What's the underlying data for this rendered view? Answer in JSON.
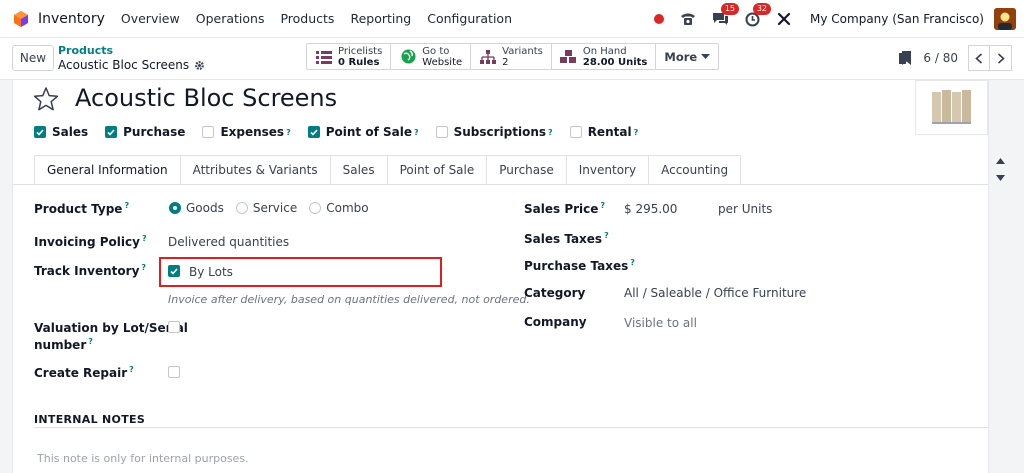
{
  "navbar": {
    "app_name": "Inventory",
    "menu": [
      "Overview",
      "Operations",
      "Products",
      "Reporting",
      "Configuration"
    ],
    "messages_badge": "15",
    "activities_badge": "32",
    "company": "My Company (San Francisco)"
  },
  "control": {
    "new_label": "New",
    "breadcrumb_parent": "Products",
    "breadcrumb_current": "Acoustic Bloc Screens",
    "smart_buttons": {
      "pricelists_title": "Pricelists",
      "pricelists_value": "0 Rules",
      "website_title": "Go to",
      "website_value": "Website",
      "variants_title": "Variants",
      "variants_value": "2",
      "onhand_title": "On Hand",
      "onhand_value": "28.00 Units",
      "more_label": "More"
    },
    "pager": "6 / 80"
  },
  "product": {
    "name": "Acoustic Bloc Screens",
    "flags": {
      "sales": "Sales",
      "purchase": "Purchase",
      "expenses": "Expenses",
      "pos": "Point of Sale",
      "subscriptions": "Subscriptions",
      "rental": "Rental"
    }
  },
  "tabs": [
    "General Information",
    "Attributes & Variants",
    "Sales",
    "Point of Sale",
    "Purchase",
    "Inventory",
    "Accounting"
  ],
  "form": {
    "product_type_label": "Product Type",
    "type_goods": "Goods",
    "type_service": "Service",
    "type_combo": "Combo",
    "invoicing_policy_label": "Invoicing Policy",
    "invoicing_policy_value": "Delivered quantities",
    "track_inventory_label": "Track Inventory",
    "track_inventory_value": "By Lots",
    "invoicing_hint": "Invoice after delivery, based on quantities delivered, not ordered.",
    "valuation_label_1": "Valuation by Lot/Serial",
    "valuation_label_2": "number",
    "create_repair_label": "Create Repair",
    "sales_price_label": "Sales Price",
    "sales_price_value": "$ 295.00",
    "sales_price_unit": "per Units",
    "sales_taxes_label": "Sales Taxes",
    "purchase_taxes_label": "Purchase Taxes",
    "category_label": "Category",
    "category_value": "All / Saleable / Office Furniture",
    "company_label": "Company",
    "company_value": "Visible to all",
    "question_mark": "?"
  },
  "notes": {
    "title": "INTERNAL NOTES",
    "placeholder": "This note is only for internal purposes."
  },
  "colors": {
    "accent": "#017e84",
    "highlight": "#e11d1d",
    "badge": "#dc2626"
  }
}
